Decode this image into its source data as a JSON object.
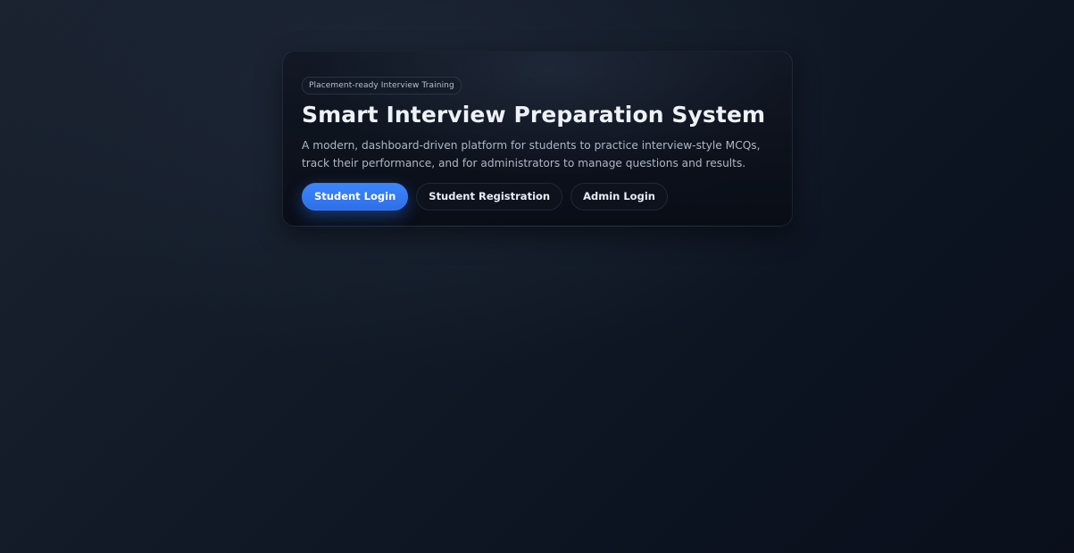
{
  "hero": {
    "eyebrow": "Placement-ready Interview Training",
    "title": "Smart Interview Preparation System",
    "subtitle": "A modern, dashboard-driven platform for students to practice interview-style MCQs, track their performance, and for administrators to manage questions and results."
  },
  "actions": {
    "student_login": "Student Login",
    "student_registration": "Student Registration",
    "admin_login": "Admin Login"
  },
  "colors": {
    "accent": "#2f6fe6",
    "background": "#121a27"
  }
}
